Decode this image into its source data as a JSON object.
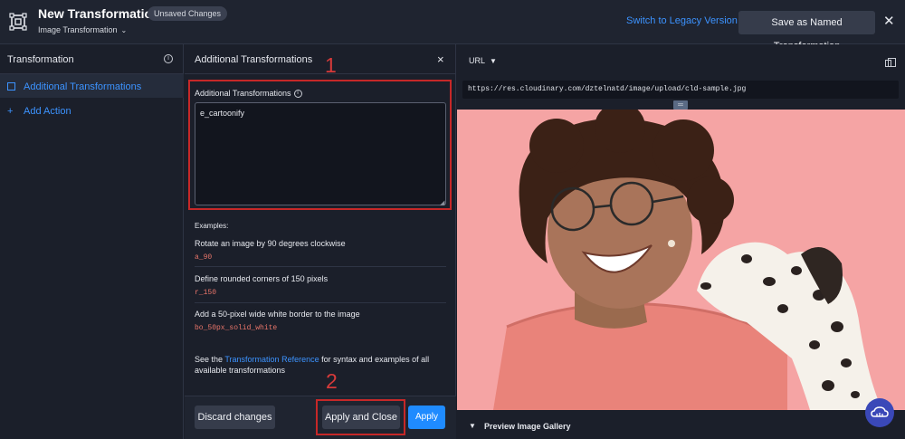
{
  "header": {
    "title": "New Transformation",
    "badge": "Unsaved Changes",
    "subtitle": "Image Transformation",
    "legacy_link": "Switch to Legacy Version",
    "save_named": "Save as Named Transformation",
    "close": "✕"
  },
  "sidebar": {
    "title": "Transformation",
    "items": [
      {
        "label": "Additional Transformations",
        "icon": "square-icon",
        "active": true
      },
      {
        "label": "Add Action",
        "icon": "plus-icon",
        "active": false
      }
    ]
  },
  "panel": {
    "title": "Additional Transformations",
    "close": "×",
    "field_label": "Additional Transformations",
    "field_value": "e_cartoonify",
    "examples_title": "Examples:",
    "examples": [
      {
        "desc": "Rotate an image by 90 degrees clockwise",
        "code": "a_90"
      },
      {
        "desc": "Define rounded corners of 150 pixels",
        "code": "r_150"
      },
      {
        "desc": "Add a 50-pixel wide white border to the image",
        "code": "bo_50px_solid_white"
      }
    ],
    "ref_prefix": "See the ",
    "ref_link": "Transformation Reference",
    "ref_suffix": " for syntax and examples of all available transformations",
    "discard": "Discard changes",
    "apply_close": "Apply and Close",
    "apply": "Apply"
  },
  "annotations": {
    "callout_1": "1",
    "callout_2": "2"
  },
  "preview": {
    "url_label": "URL",
    "url": "https://res.cloudinary.com/dztelnatd/image/upload/cld-sample.jpg",
    "gallery": "Preview Image Gallery"
  },
  "colors": {
    "accent": "#3c93ff",
    "primary_button": "#1f8bff",
    "highlight": "#c62828",
    "image_bg": "#f5a4a4"
  }
}
